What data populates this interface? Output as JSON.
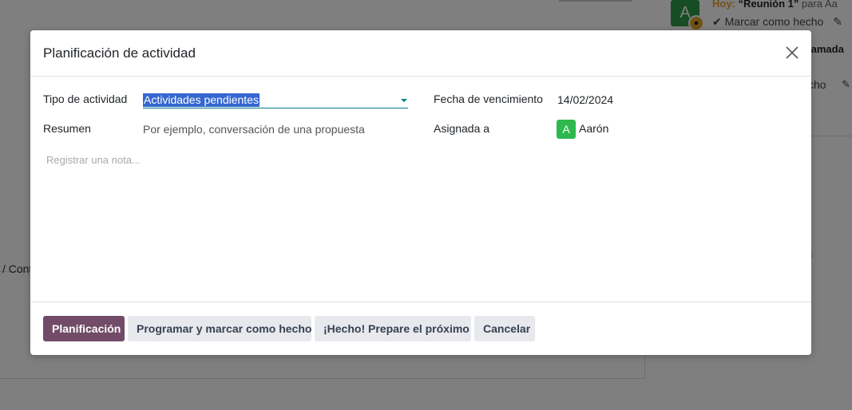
{
  "background": {
    "avatar_letter": "A",
    "activity_today_label": "Hoy:",
    "activity_title": "“Reunión 1”",
    "activity_for": "para Aa",
    "mark_done_label": "Marcar como hecho",
    "call_label": "lamada",
    "done_fragment": "cho",
    "breadcrumb_fragment": "/ Cont",
    "faint_text": "s"
  },
  "dialog": {
    "title": "Planificación de actividad",
    "close_icon": "close-icon",
    "fields": {
      "activity_type_label": "Tipo de actividad",
      "activity_type_value": "Actividades pendientes",
      "due_date_label": "Fecha de vencimiento",
      "due_date_value": "14/02/2024",
      "summary_label": "Resumen",
      "summary_placeholder": "Por ejemplo, conversación de una propuesta",
      "assigned_label": "Asignada a",
      "assignee_initial": "A",
      "assignee_name": "Aarón",
      "note_placeholder": "Registrar una nota..."
    },
    "buttons": {
      "schedule": "Planificación",
      "schedule_mark_done": "Programar y marcar como hecho",
      "done_schedule_next": "¡Hecho! Prepare el próximo",
      "cancel": "Cancelar"
    }
  },
  "colors": {
    "primary": "#714b67",
    "accent": "#017e84",
    "selection": "#3567d0",
    "avatar_green": "#2eb84e"
  }
}
